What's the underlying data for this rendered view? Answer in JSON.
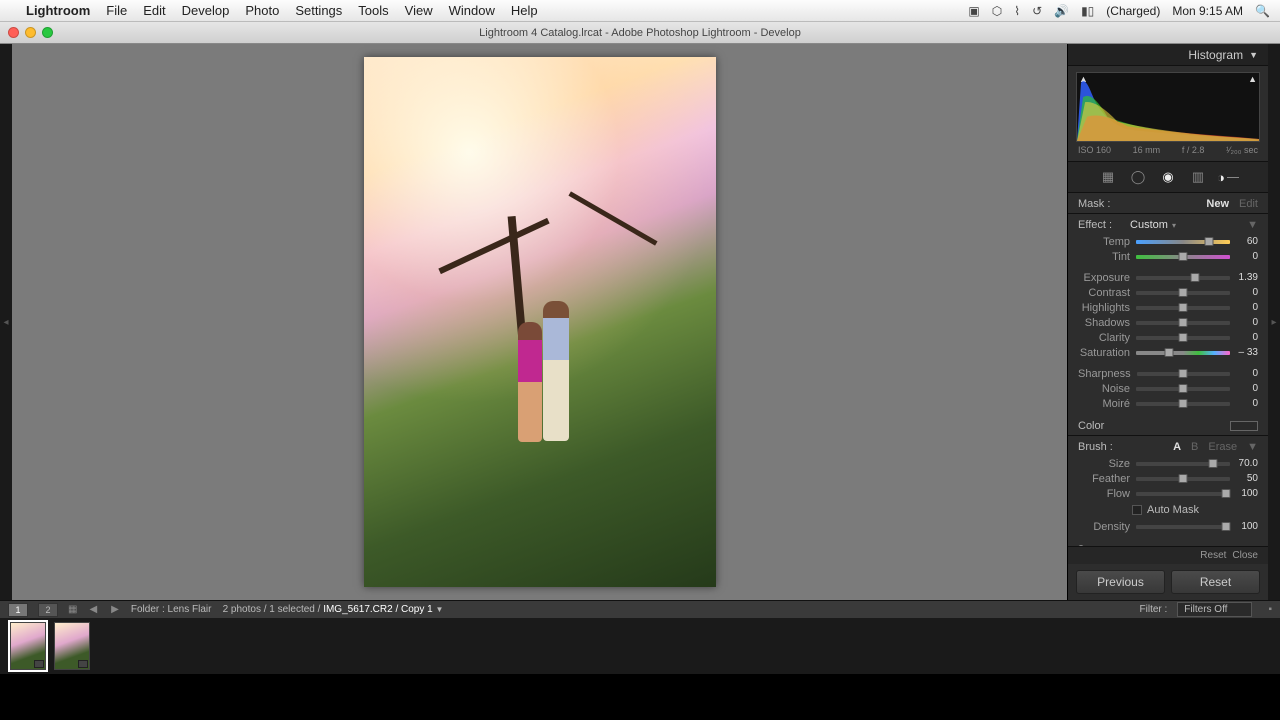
{
  "menubar": {
    "app": "Lightroom",
    "items": [
      "File",
      "Edit",
      "Develop",
      "Photo",
      "Settings",
      "Tools",
      "View",
      "Window",
      "Help"
    ],
    "battery": "(Charged)",
    "clock": "Mon 9:15 AM"
  },
  "titlebar": {
    "title": "Lightroom 4 Catalog.lrcat - Adobe Photoshop Lightroom - Develop"
  },
  "panel": {
    "histogram_label": "Histogram",
    "meta": {
      "iso": "ISO 160",
      "focal": "16 mm",
      "aperture": "f / 2.8",
      "shutter": "¹⁄₂₀₀ sec"
    },
    "mask": {
      "label": "Mask :",
      "new": "New",
      "edit": "Edit"
    },
    "effect": {
      "label": "Effect :",
      "value": "Custom"
    },
    "sliders1": [
      {
        "label": "Temp",
        "value": "60",
        "pos": 78,
        "track": "temp"
      },
      {
        "label": "Tint",
        "value": "0",
        "pos": 50,
        "track": "tint"
      }
    ],
    "sliders2": [
      {
        "label": "Exposure",
        "value": "1.39",
        "pos": 63
      },
      {
        "label": "Contrast",
        "value": "0",
        "pos": 50
      },
      {
        "label": "Highlights",
        "value": "0",
        "pos": 50
      },
      {
        "label": "Shadows",
        "value": "0",
        "pos": 50
      },
      {
        "label": "Clarity",
        "value": "0",
        "pos": 50
      },
      {
        "label": "Saturation",
        "value": "– 33",
        "pos": 35,
        "track": "sat"
      }
    ],
    "sliders3": [
      {
        "label": "Sharpness",
        "value": "0",
        "pos": 50
      },
      {
        "label": "Noise",
        "value": "0",
        "pos": 50
      },
      {
        "label": "Moiré",
        "value": "0",
        "pos": 50
      }
    ],
    "color_label": "Color",
    "brush": {
      "label": "Brush :",
      "a": "A",
      "b": "B",
      "erase": "Erase"
    },
    "sliders4": [
      {
        "label": "Size",
        "value": "70.0",
        "pos": 82
      },
      {
        "label": "Feather",
        "value": "50",
        "pos": 50
      },
      {
        "label": "Flow",
        "value": "100",
        "pos": 96
      }
    ],
    "automask": "Auto Mask",
    "sliders5": [
      {
        "label": "Density",
        "value": "100",
        "pos": 96
      }
    ],
    "footer": {
      "reset": "Reset",
      "close": "Close"
    },
    "buttons": {
      "prev": "Previous",
      "reset": "Reset"
    }
  },
  "filmstrip": {
    "tab1": "1",
    "tab2": "2",
    "folder_label": "Folder :",
    "folder": "Lens Flair",
    "count": "2 photos / 1 selected /",
    "file": "IMG_5617.CR2 / Copy 1",
    "filter_label": "Filter :",
    "filter_value": "Filters Off"
  }
}
